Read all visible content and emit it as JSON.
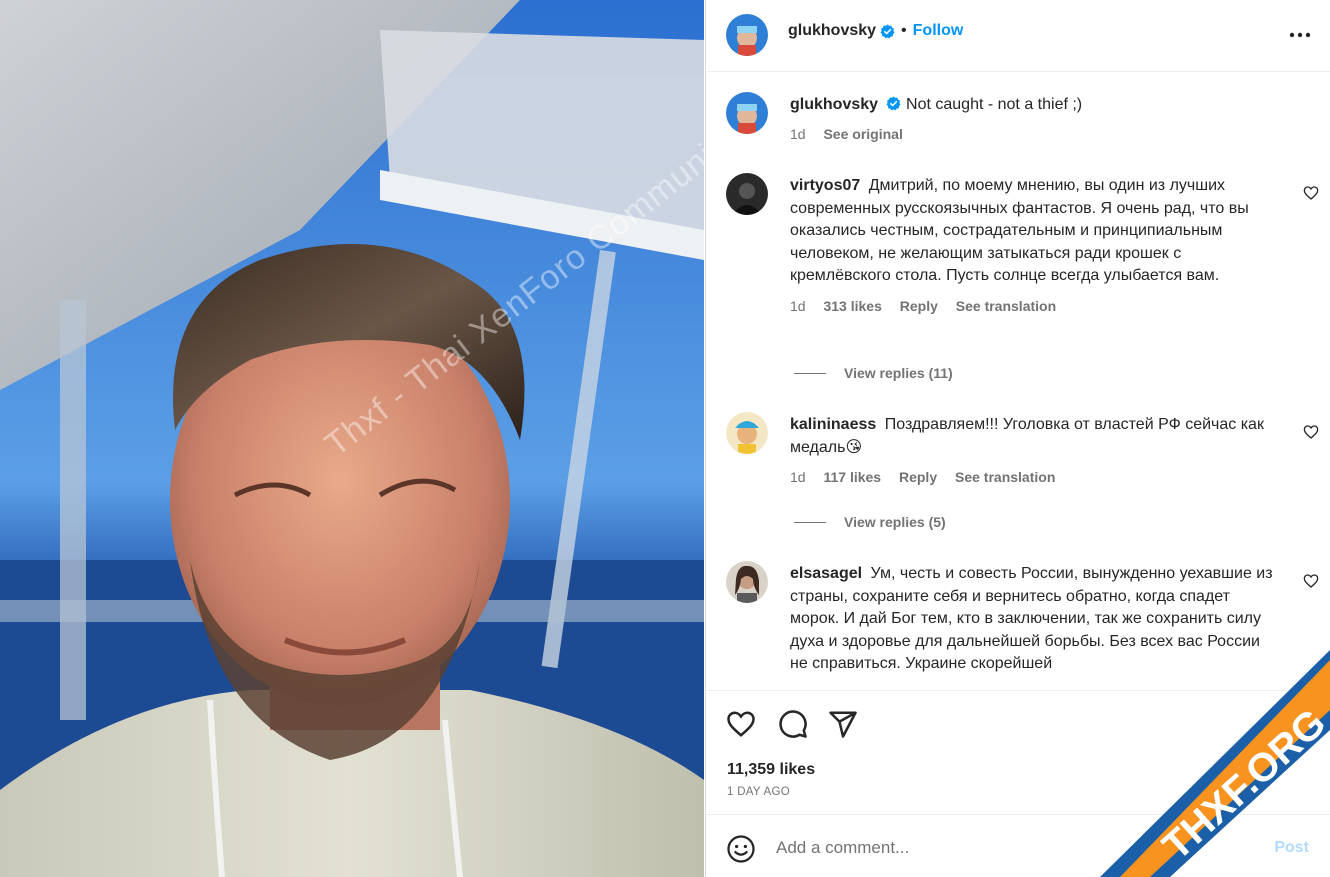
{
  "photo": {
    "watermark": "Thxf - Thai XenForo Community"
  },
  "header": {
    "username": "glukhovsky",
    "separator": "•",
    "follow_label": "Follow",
    "more_icon": "more-horizontal-icon"
  },
  "caption": {
    "username": "glukhovsky",
    "text": "Not caught - not a thief ;)",
    "time": "1d",
    "see_original": "See original"
  },
  "comments": [
    {
      "username": "virtyos07",
      "text": "Дмитрий, по моему мнению, вы один из лучших современных русскоязычных фантастов. Я очень рад, что вы оказались честным, сострадательным и принципиальным человеком, не желающим затыкаться ради крошек с кремлёвского стола. Пусть солнце всегда улыбается вам.",
      "time": "1d",
      "likes": "313 likes",
      "reply": "Reply",
      "translate": "See translation",
      "view_replies": "View replies (11)"
    },
    {
      "username": "kalininaess",
      "text": "Поздравляем!!! Уголовка от властей РФ сейчас как медаль😘",
      "time": "1d",
      "likes": "117 likes",
      "reply": "Reply",
      "translate": "See translation",
      "view_replies": "View replies (5)"
    },
    {
      "username": "elsasagel",
      "text": "Ум, честь и совесть России, вынужденно уехавшие из страны, сохраните себя и вернитесь обратно, когда спадет морок. И дай Бог тем, кто в заключении, так же сохранить силу духа и здоровье для дальнейшей борьбы. Без всех вас России не справиться. Украине скорейшей"
    }
  ],
  "actions": {
    "like_icon": "heart-icon",
    "comment_icon": "comment-icon",
    "share_icon": "share-icon",
    "likes": "11,359 likes",
    "time_ago": "1 DAY AGO"
  },
  "composer": {
    "emoji_icon": "emoji-icon",
    "placeholder": "Add a comment...",
    "post_label": "Post"
  },
  "corner_logo": {
    "text": "THXF.ORG"
  },
  "colors": {
    "accent": "#0095f6",
    "muted": "#737373",
    "border": "#efefef",
    "logo_orange": "#f7931e",
    "logo_blue": "#1a5fa8"
  }
}
